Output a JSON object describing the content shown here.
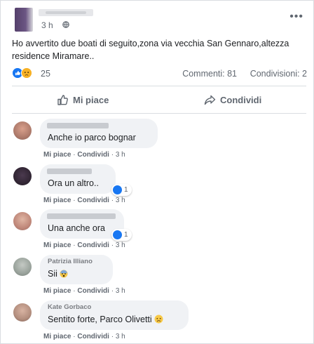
{
  "post": {
    "time": "3 h",
    "text_line1": "Ho avvertito due boati di seguito,zona via vecchia San Gennaro,altezza",
    "text_line2": "residence Miramare..",
    "reaction_count": "25",
    "comments_label": "Commenti: 81",
    "shares_label": "Condivisioni: 2",
    "like_label": "Mi piace",
    "share_label": "Condividi"
  },
  "comments": [
    {
      "name": "",
      "text": "Anche io parco bognar",
      "likes": "",
      "meta_like": "Mi piace",
      "meta_share": "Condividi",
      "time": "3 h"
    },
    {
      "name": "",
      "text": "Ora un altro..",
      "likes": "1",
      "meta_like": "Mi piace",
      "meta_share": "Condividi",
      "time": "3 h"
    },
    {
      "name": "",
      "text": "Una anche ora",
      "likes": "1",
      "meta_like": "Mi piace",
      "meta_share": "Condividi",
      "time": "3 h"
    },
    {
      "name": "Patrizia Illiano",
      "text": "Sii",
      "likes": "",
      "meta_like": "Mi piace",
      "meta_share": "Condividi",
      "time": "3 h"
    },
    {
      "name": "Kate Gorbaco",
      "text": "Sentito forte, Parco Olivetti",
      "likes": "",
      "meta_like": "Mi piace",
      "meta_share": "Condividi",
      "time": "3 h"
    }
  ],
  "icons": {
    "globe": "globe-icon",
    "more": "more-options-icon",
    "like": "thumbs-up-icon",
    "share": "share-arrow-icon",
    "sad": "sad-face-icon",
    "scared": "scared-face-icon"
  },
  "colors": {
    "facebook_blue": "#1877f2",
    "bubble": "#f0f2f5",
    "meta_text": "#606770"
  }
}
